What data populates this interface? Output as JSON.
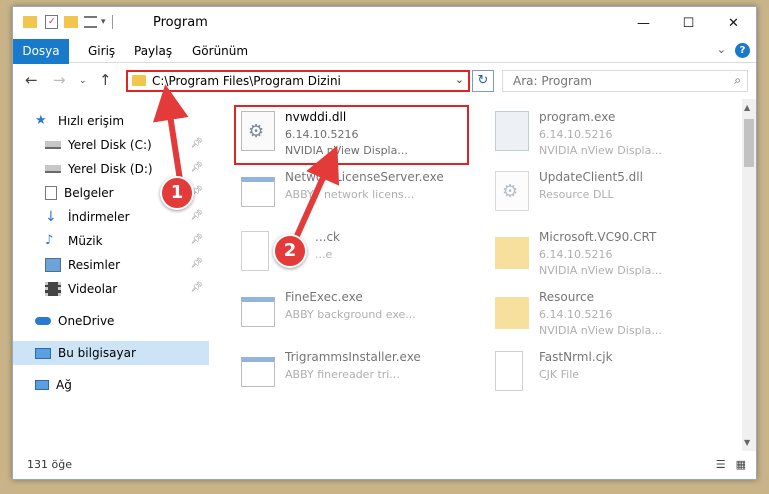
{
  "window": {
    "title": "Program",
    "controls": {
      "minimize": "—",
      "maximize": "☐",
      "close": "✕"
    }
  },
  "ribbon": {
    "tabs": [
      "Dosya",
      "Giriş",
      "Paylaş",
      "Görünüm"
    ]
  },
  "address": {
    "path": "C:\\Program Files\\Program Dizini",
    "search_placeholder": "Ara: Program"
  },
  "sidebar": {
    "items": [
      {
        "label": "Hızlı erişim",
        "icon": "star-icon",
        "pinned": false
      },
      {
        "label": "Yerel Disk (C:)",
        "icon": "drive-icon",
        "pinned": true
      },
      {
        "label": "Yerel Disk (D:)",
        "icon": "drive-icon",
        "pinned": true
      },
      {
        "label": "Belgeler",
        "icon": "documents-icon",
        "pinned": true
      },
      {
        "label": "İndirmeler",
        "icon": "download-icon",
        "pinned": true
      },
      {
        "label": "Müzik",
        "icon": "music-icon",
        "pinned": true
      },
      {
        "label": "Resimler",
        "icon": "pictures-icon",
        "pinned": true
      },
      {
        "label": "Videolar",
        "icon": "video-icon",
        "pinned": true
      },
      {
        "label": "OneDrive",
        "icon": "cloud-icon",
        "pinned": false
      },
      {
        "label": "Bu bilgisayar",
        "icon": "computer-icon",
        "pinned": false
      },
      {
        "label": "Ağ",
        "icon": "network-icon",
        "pinned": false
      }
    ]
  },
  "files": [
    {
      "name": "nvwddi.dll",
      "line1": "6.14.10.5216",
      "line2": "NVIDIA nView Displa...",
      "icon": "dll-gear-icon"
    },
    {
      "name": "program.exe",
      "line1": "6.14.10.5216",
      "line2": "NVIDIA nView Displa...",
      "icon": "exe-icon"
    },
    {
      "name": "NetworkLicenseServer.exe",
      "line1": "ABBYY network licens...",
      "line2": "",
      "icon": "exe-window-icon"
    },
    {
      "name": "UpdateClient5.dll",
      "line1": "Resource DLL",
      "line2": "",
      "icon": "dll-gear-icon"
    },
    {
      "name": "...ck",
      "line1": "...e",
      "line2": "",
      "icon": "file-icon"
    },
    {
      "name": "Microsoft.VC90.CRT",
      "line1": "6.14.10.5216",
      "line2": "NVIDIA nView Displa...",
      "icon": "folder-icon"
    },
    {
      "name": "FineExec.exe",
      "line1": "ABBY background exe...",
      "line2": "",
      "icon": "exe-window-icon"
    },
    {
      "name": "Resource",
      "line1": "6.14.10.5216",
      "line2": "NVIDIA nView Displa...",
      "icon": "folder-icon"
    },
    {
      "name": "TrigrammsInstaller.exe",
      "line1": "ABBY finereader tri...",
      "line2": "",
      "icon": "exe-window-icon"
    },
    {
      "name": "FastNrml.cjk",
      "line1": "CJK File",
      "line2": "",
      "icon": "file-icon"
    }
  ],
  "status": {
    "count": "131 öğe"
  },
  "annotations": {
    "badge1": "1",
    "badge2": "2"
  },
  "colors": {
    "accent": "#1979ca",
    "highlight": "#e02424",
    "badge": "#e33a3a"
  }
}
